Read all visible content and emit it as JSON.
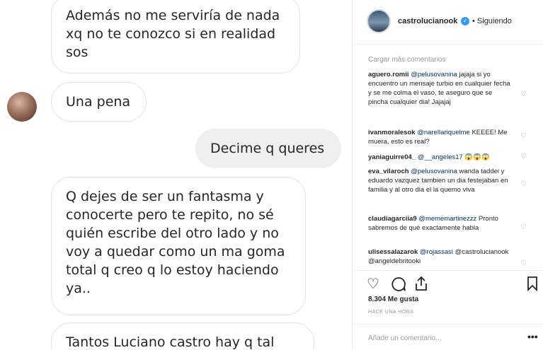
{
  "chat": {
    "messages": [
      {
        "text": "Además no me serviría de nada xq no te conozco si en realidad sos"
      },
      {
        "text": "Una pena"
      },
      {
        "text": "Decime q queres"
      },
      {
        "text": "Q dejes de ser un fantasma y conocerte pero te repito, no sé quién escribe del otro lado y no voy a quedar como un ma goma total q creo q lo estoy haciendo ya.."
      },
      {
        "text": "Tantos Luciano castro hay q tal"
      }
    ]
  },
  "post": {
    "username": "castrolucianook",
    "follow_status": "• Siguiendo",
    "load_more": "Cargar más comentarios",
    "comments": [
      {
        "user": "aguero.romii",
        "mention": "@pelusovanina",
        "text": "jajaja si yo encuentro un mensaje turbio en cualquier fecha y se me colma el vaso, te aseguro que se pincha cualquier dia! Jajajaj"
      },
      {
        "user": "ivanmoralesok",
        "mention": "@narellariquelme",
        "text": "KEEEE! Me muera, esto es real?"
      },
      {
        "user": "yaniaguirre04_",
        "mention": "@__angeles17",
        "text": "😱😱😱"
      },
      {
        "user": "eva_vilaroch",
        "mention": "@pelusovanina",
        "text": "wanda taddei y eduardo vazquez tambien un dia festejaban en familia y al otro dia el la quemo viva"
      },
      {
        "user": "claudiagarciia9",
        "mention": "@mememartinezzz",
        "text": "Pronto sabremos de qué exactamente habla"
      },
      {
        "user": "ulisessalazarok",
        "mention": "@rojassasi",
        "text": "@castrolucianook @angeldebritooki"
      }
    ],
    "likes": "8.304 Me gusta",
    "time": "HACE UNA HORA",
    "add_comment_placeholder": "Añade un comentario...",
    "more_options": "•••"
  }
}
